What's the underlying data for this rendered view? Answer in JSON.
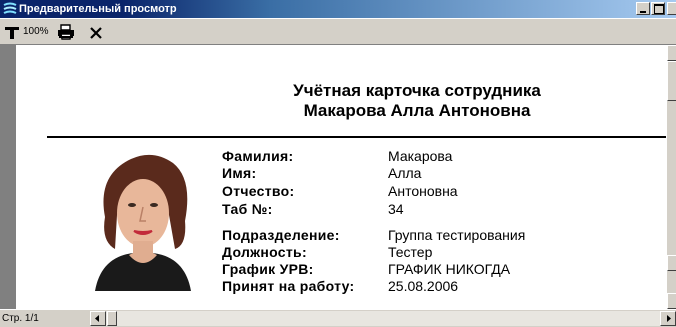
{
  "window": {
    "title": "Предварительный просмотр",
    "icon": "app-logo-icon"
  },
  "toolbar": {
    "zoom_icon": "zoom-pin-icon",
    "zoom_label": "100%",
    "print_icon": "printer-icon",
    "close_icon": "close-icon"
  },
  "report": {
    "title_line1": "Учётная карточка сотрудника",
    "title_line2": "Макарова Алла Антоновна",
    "fields": [
      {
        "label": "Фамилия:",
        "value": "Макарова"
      },
      {
        "label": "Имя:",
        "value": "Алла"
      },
      {
        "label": "Отчество:",
        "value": "Антоновна"
      },
      {
        "label": "Таб №:",
        "value": "34"
      },
      {
        "label": "Подразделение:",
        "value": "Группа тестирования"
      },
      {
        "label": "Должность:",
        "value": "Тестер"
      },
      {
        "label": "График УРВ:",
        "value": "ГРАФИК НИКОГДА"
      },
      {
        "label": "Принят на работу:",
        "value": "25.08.2006"
      }
    ]
  },
  "status": {
    "page_indicator": "Стр. 1/1"
  },
  "colors": {
    "titlebar": "#0a246a",
    "window_bg": "#d4d0c8",
    "page_bg": "#ffffff",
    "viewport_bg": "#808080"
  }
}
